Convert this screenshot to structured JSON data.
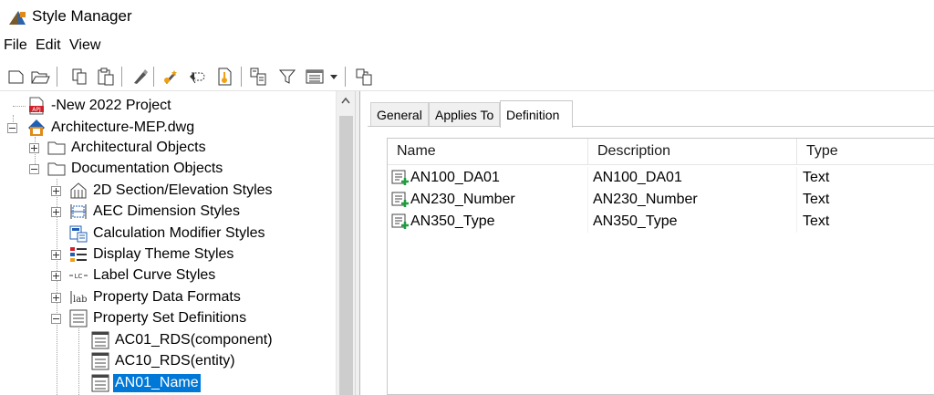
{
  "window": {
    "title": "Style Manager"
  },
  "menu": {
    "items": [
      "File",
      "Edit",
      "View"
    ]
  },
  "toolbar": {
    "buttons": [
      "new-icon",
      "open-icon",
      "copy-icon",
      "paste-icon",
      "purge-icon",
      "edit-style-icon",
      "sync-icon",
      "update-standards-icon",
      "toggle-view-icon",
      "filter-icon",
      "view-mode-icon",
      "view-mode-dropdown-icon",
      "help-icon"
    ]
  },
  "tree": {
    "nodes": [
      {
        "label": "-New 2022 Project",
        "icon": "project-apj-icon"
      },
      {
        "label": "Architecture-MEP.dwg",
        "icon": "drawing-file-icon"
      },
      {
        "label": "Architectural Objects",
        "icon": "folder-icon"
      },
      {
        "label": "Documentation Objects",
        "icon": "folder-icon"
      },
      {
        "label": "2D Section/Elevation Styles",
        "icon": "section-elevation-icon"
      },
      {
        "label": "AEC Dimension Styles",
        "icon": "aec-dimension-icon"
      },
      {
        "label": "Calculation Modifier Styles",
        "icon": "calculation-modifier-icon"
      },
      {
        "label": "Display Theme Styles",
        "icon": "display-theme-icon"
      },
      {
        "label": "Label Curve Styles",
        "icon": "label-curve-icon",
        "icon_text": "LC"
      },
      {
        "label": "Property Data Formats",
        "icon": "property-data-format-icon",
        "icon_text": "lab"
      },
      {
        "label": "Property Set Definitions",
        "icon": "property-set-icon"
      },
      {
        "label": "AC01_RDS(component)",
        "icon": "property-set-item-icon"
      },
      {
        "label": "AC10_RDS(entity)",
        "icon": "property-set-item-icon"
      },
      {
        "label": "AN01_Name",
        "icon": "property-set-item-icon",
        "selected": true
      }
    ]
  },
  "tabs": [
    {
      "label": "General"
    },
    {
      "label": "Applies To"
    },
    {
      "label": "Definition",
      "active": true
    }
  ],
  "definition_table": {
    "columns": [
      "Name",
      "Description",
      "Type"
    ],
    "rows": [
      {
        "name": "AN100_DA01",
        "description": "AN100_DA01",
        "type": "Text"
      },
      {
        "name": "AN230_Number",
        "description": "AN230_Number",
        "type": "Text"
      },
      {
        "name": "AN350_Type",
        "description": "AN350_Type",
        "type": "Text"
      }
    ]
  },
  "colors": {
    "selection": "#0078d7",
    "add_badge": "#1e9e3e",
    "project_red": "#d0202a",
    "drawing_blue": "#1f5fb5"
  }
}
